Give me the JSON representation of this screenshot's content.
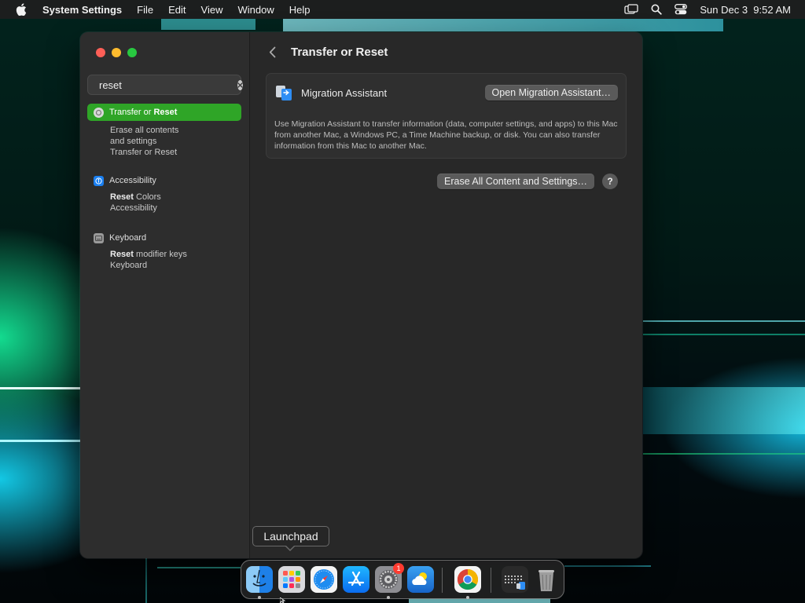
{
  "menubar": {
    "app_name": "System Settings",
    "items": [
      "File",
      "Edit",
      "View",
      "Window",
      "Help"
    ],
    "clock": "Sun Dec 3  9:52 AM"
  },
  "search": {
    "value": "reset"
  },
  "sidebar": {
    "results": [
      {
        "section": "Transfer or Reset",
        "section_pre": "Transfer or ",
        "section_bold": "Reset",
        "sub": [
          "Erase all contents",
          "and settings",
          "Transfer or Reset"
        ]
      },
      {
        "section": "Accessibility",
        "sub_bold": "Reset",
        "sub_rest": " Colors",
        "sub2": "Accessibility"
      },
      {
        "section": "Keyboard",
        "sub_bold": "Reset",
        "sub_rest": " modifier keys",
        "sub2": "Keyboard"
      }
    ]
  },
  "main": {
    "title": "Transfer or Reset",
    "migration": {
      "label": "Migration Assistant",
      "button": "Open Migration Assistant…",
      "description": "Use Migration Assistant to transfer information (data, computer settings, and apps) to this Mac from another Mac, a Windows PC, a Time Machine backup, or disk. You can also transfer information from this Mac to another Mac."
    },
    "erase_button": "Erase All Content and Settings…",
    "help": "?"
  },
  "tooltip": "Launchpad",
  "dock": {
    "apps": [
      "Finder",
      "Launchpad",
      "Safari",
      "App Store",
      "System Settings",
      "Weather",
      "Chrome",
      "Migration Assistant",
      "Trash"
    ],
    "settings_badge": "1"
  },
  "colors": {
    "accent": "#2fa527",
    "window_bg": "#282828",
    "sidebar_bg": "#2d2d2d"
  }
}
